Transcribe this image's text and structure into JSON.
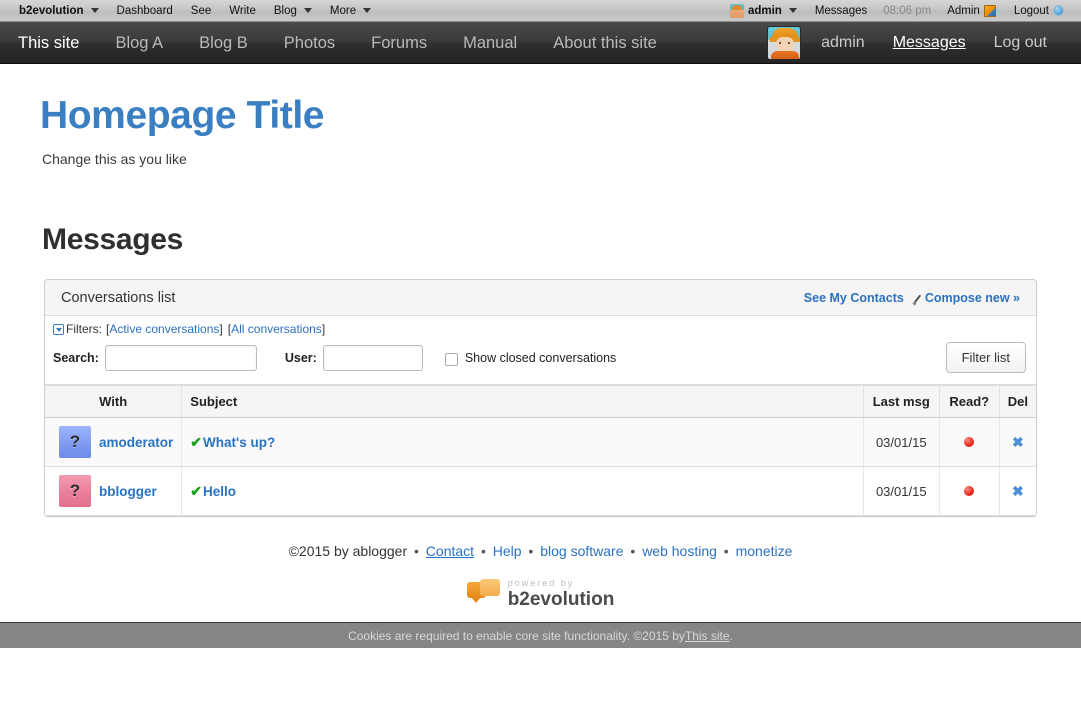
{
  "evobar": {
    "brand": "b2evolution",
    "left_items": [
      {
        "label": "b2evolution",
        "caret": true
      },
      {
        "label": "Dashboard",
        "caret": false
      },
      {
        "label": "See",
        "caret": false
      },
      {
        "label": "Write",
        "caret": false
      },
      {
        "label": "Blog",
        "caret": true
      },
      {
        "label": "More",
        "caret": true
      }
    ],
    "user": "admin",
    "messages_label": "Messages",
    "time": "08:06 pm",
    "admin_label": "Admin",
    "logout_label": "Logout"
  },
  "sitenav": {
    "items": [
      {
        "label": "This site",
        "active": true
      },
      {
        "label": "Blog A",
        "active": false
      },
      {
        "label": "Blog B",
        "active": false
      },
      {
        "label": "Photos",
        "active": false
      },
      {
        "label": "Forums",
        "active": false
      },
      {
        "label": "Manual",
        "active": false
      },
      {
        "label": "About this site",
        "active": false
      }
    ],
    "user": "admin",
    "messages_label": "Messages",
    "logout_label": "Log out"
  },
  "header": {
    "title": "Homepage Title",
    "tagline": "Change this as you like"
  },
  "section": {
    "title": "Messages"
  },
  "panel": {
    "title": "Conversations list",
    "see_contacts": "See My Contacts",
    "compose_new": "Compose new »"
  },
  "filters": {
    "label": "Filters:",
    "open_bracket": "[",
    "close_bracket": "]",
    "active_conversations": "Active conversations",
    "all_conversations": "All conversations",
    "search_label": "Search:",
    "search_value": "",
    "user_label": "User:",
    "user_value": "",
    "show_closed_label": "Show closed conversations",
    "filter_button": "Filter list"
  },
  "table": {
    "headers": {
      "with": "With",
      "subject": "Subject",
      "last_msg": "Last msg",
      "read": "Read?",
      "del": "Del"
    },
    "rows": [
      {
        "avatar_initial": "?",
        "avatar_color": "blue",
        "user": "amoderator",
        "check": "✔",
        "subject": "What's up?",
        "last_msg": "03/01/15",
        "read_status": "unread",
        "del": "✖"
      },
      {
        "avatar_initial": "?",
        "avatar_color": "pink",
        "user": "bblogger",
        "check": "✔",
        "subject": "Hello",
        "last_msg": "03/01/15",
        "read_status": "unread",
        "del": "✖"
      }
    ]
  },
  "footer": {
    "copyright": "©2015 by ablogger",
    "links": [
      "Contact",
      "Help",
      "blog software",
      "web hosting",
      "monetize"
    ],
    "separator": "•",
    "powered_small": "powered by",
    "powered_big": "b2evolution"
  },
  "cookiebar": {
    "text_before": "Cookies are required to enable core site functionality. ©2015 by ",
    "link": "This site",
    "text_after": "."
  },
  "colors": {
    "link_blue": "#2b72c0",
    "title_blue": "#3a7fc1",
    "check_green": "#18a018",
    "unread_red": "#ee2d20",
    "del_blue": "#4a90d9"
  }
}
